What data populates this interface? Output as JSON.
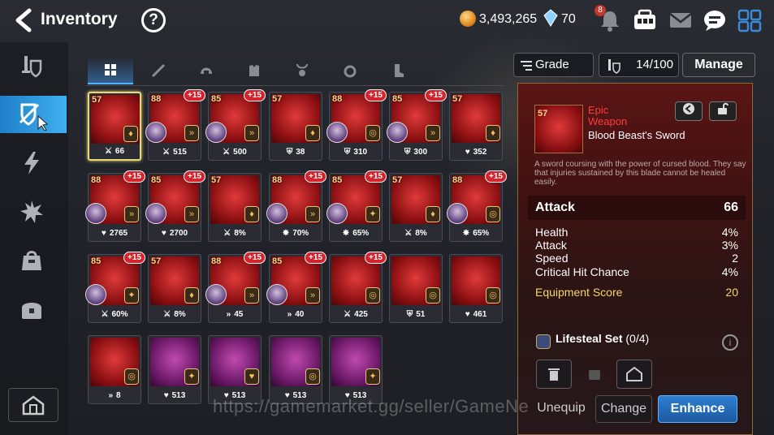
{
  "header": {
    "title": "Inventory",
    "help": "?",
    "gold": "3,493,265",
    "crystal": "70",
    "bell_badge": "8"
  },
  "tabs": [
    "all",
    "weapon",
    "helmet",
    "armor",
    "necklace",
    "ring",
    "boots"
  ],
  "controls": {
    "grade_label": "Grade",
    "count": "14/100",
    "manage": "Manage"
  },
  "items": [
    {
      "lv": "57",
      "plus": "",
      "hero": false,
      "set": "lifesteal",
      "stat": "66",
      "stat_icon": "attack",
      "purple": false
    },
    {
      "lv": "88",
      "plus": "+15",
      "hero": true,
      "set": "speed",
      "stat": "515",
      "stat_icon": "attack",
      "purple": false
    },
    {
      "lv": "85",
      "plus": "+15",
      "hero": true,
      "set": "speed",
      "stat": "500",
      "stat_icon": "attack",
      "purple": false
    },
    {
      "lv": "57",
      "plus": "",
      "hero": false,
      "set": "lifesteal",
      "stat": "38",
      "stat_icon": "defense",
      "purple": false
    },
    {
      "lv": "88",
      "plus": "+15",
      "hero": true,
      "set": "counter",
      "stat": "310",
      "stat_icon": "defense",
      "purple": false
    },
    {
      "lv": "85",
      "plus": "+15",
      "hero": true,
      "set": "speed",
      "stat": "300",
      "stat_icon": "defense",
      "purple": false
    },
    {
      "lv": "57",
      "plus": "",
      "hero": false,
      "set": "lifesteal",
      "stat": "352",
      "stat_icon": "health",
      "purple": false
    },
    {
      "lv": "88",
      "plus": "+15",
      "hero": true,
      "set": "speed",
      "stat": "2765",
      "stat_icon": "health",
      "purple": false
    },
    {
      "lv": "85",
      "plus": "+15",
      "hero": true,
      "set": "speed",
      "stat": "2700",
      "stat_icon": "health",
      "purple": false
    },
    {
      "lv": "57",
      "plus": "",
      "hero": false,
      "set": "lifesteal",
      "stat": "8%",
      "stat_icon": "attack",
      "purple": false
    },
    {
      "lv": "88",
      "plus": "+15",
      "hero": true,
      "set": "speed",
      "stat": "70%",
      "stat_icon": "crit",
      "purple": false
    },
    {
      "lv": "85",
      "plus": "+15",
      "hero": true,
      "set": "destruction",
      "stat": "65%",
      "stat_icon": "crit",
      "purple": false
    },
    {
      "lv": "57",
      "plus": "",
      "hero": false,
      "set": "lifesteal",
      "stat": "8%",
      "stat_icon": "attack",
      "purple": false
    },
    {
      "lv": "88",
      "plus": "+15",
      "hero": true,
      "set": "counter",
      "stat": "65%",
      "stat_icon": "crit",
      "purple": false
    },
    {
      "lv": "85",
      "plus": "+15",
      "hero": true,
      "set": "destruction",
      "stat": "60%",
      "stat_icon": "attack",
      "purple": false
    },
    {
      "lv": "57",
      "plus": "",
      "hero": false,
      "set": "lifesteal",
      "stat": "8%",
      "stat_icon": "attack",
      "purple": false
    },
    {
      "lv": "88",
      "plus": "+15",
      "hero": true,
      "set": "speed",
      "stat": "45",
      "stat_icon": "speed",
      "purple": false
    },
    {
      "lv": "85",
      "plus": "+15",
      "hero": true,
      "set": "speed",
      "stat": "40",
      "stat_icon": "speed",
      "purple": false
    },
    {
      "lv": "",
      "plus": "+15",
      "hero": false,
      "set": "counter",
      "stat": "425",
      "stat_icon": "attack",
      "purple": false
    },
    {
      "lv": "",
      "plus": "",
      "hero": false,
      "set": "counter",
      "stat": "51",
      "stat_icon": "defense",
      "purple": false
    },
    {
      "lv": "",
      "plus": "",
      "hero": false,
      "set": "counter",
      "stat": "461",
      "stat_icon": "health",
      "purple": false
    },
    {
      "lv": "",
      "plus": "",
      "hero": false,
      "set": "counter",
      "stat": "8",
      "stat_icon": "speed",
      "purple": false
    },
    {
      "lv": "",
      "plus": "",
      "hero": false,
      "set": "destruction",
      "stat": "513",
      "stat_icon": "health",
      "purple": true
    },
    {
      "lv": "",
      "plus": "",
      "hero": false,
      "set": "immunity",
      "stat": "513",
      "stat_icon": "health",
      "purple": true
    },
    {
      "lv": "",
      "plus": "",
      "hero": false,
      "set": "counter",
      "stat": "513",
      "stat_icon": "health",
      "purple": true
    },
    {
      "lv": "",
      "plus": "",
      "hero": false,
      "set": "destruction",
      "stat": "513",
      "stat_icon": "health",
      "purple": true
    }
  ],
  "detail": {
    "lv": "57",
    "rarity": "Epic",
    "type": "Weapon",
    "name": "Blood Beast's Sword",
    "description": "A sword coursing with the power of cursed blood. They say that injuries sustained by this blade cannot be healed easily.",
    "main_stat": {
      "label": "Attack",
      "value": "66"
    },
    "substats": [
      {
        "label": "Health",
        "value": "4%"
      },
      {
        "label": "Attack",
        "value": "3%"
      },
      {
        "label": "Speed",
        "value": "2"
      },
      {
        "label": "Critical Hit Chance",
        "value": "4%"
      }
    ],
    "score": {
      "label": "Equipment Score",
      "value": "20"
    },
    "set": "Lifesteal Set",
    "set_count": "(0/4)",
    "buttons": {
      "unequip": "Unequip",
      "change": "Change",
      "enhance": "Enhance"
    }
  },
  "watermark": "https://gamemarket.gg/seller/GameNe",
  "colors": {
    "accent": "#4fb3ff",
    "epic": "#ff3b3b",
    "score": "#f3d66a"
  }
}
